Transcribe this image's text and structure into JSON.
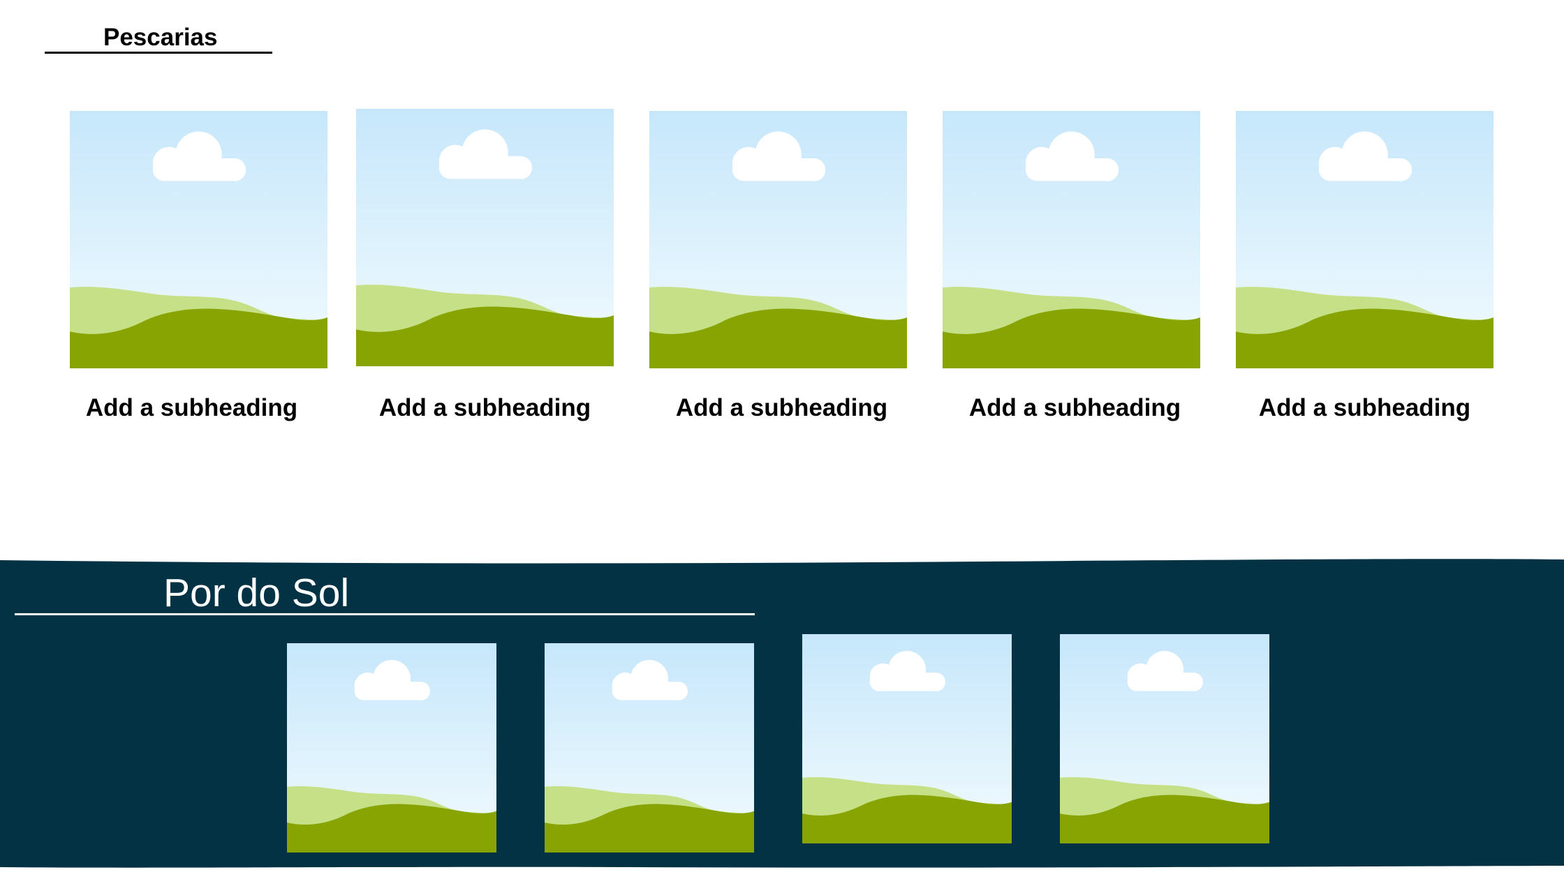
{
  "sections": {
    "pescarias": {
      "title": "Pescarias",
      "items": [
        {
          "caption": "Add a subheading",
          "image": "landscape-placeholder"
        },
        {
          "caption": "Add a subheading",
          "image": "landscape-placeholder"
        },
        {
          "caption": "Add a subheading",
          "image": "landscape-placeholder"
        },
        {
          "caption": "Add a subheading",
          "image": "landscape-placeholder"
        },
        {
          "caption": "Add a subheading",
          "image": "landscape-placeholder"
        }
      ]
    },
    "por_do_sol": {
      "title": "Por do Sol",
      "items": [
        {
          "image": "landscape-placeholder"
        },
        {
          "image": "landscape-placeholder"
        },
        {
          "image": "landscape-placeholder"
        },
        {
          "image": "landscape-placeholder"
        }
      ]
    }
  },
  "colors": {
    "page_background": "#ffffff",
    "band_background": "#023243",
    "sky_top": "#c6e7fb",
    "sky_bottom": "#f3fbfe",
    "hill_light": "#c5e086",
    "hill_dark": "#88a402",
    "cloud": "#ffffff"
  }
}
